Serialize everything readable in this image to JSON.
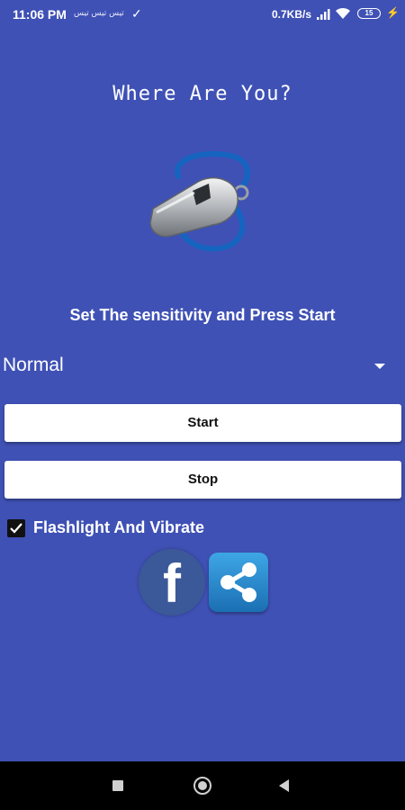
{
  "status_bar": {
    "time": "11:06 PM",
    "notifications": "تیس تیس تیس",
    "network_speed": "0.7KB/s",
    "battery_level": "15",
    "icons": [
      "download-done-icon",
      "signal-icon",
      "wifi-icon",
      "battery-icon",
      "charging-icon"
    ]
  },
  "app": {
    "title": "Where Are You?",
    "hero_icon": "whistle-icon",
    "instruction": "Set The sensitivity and Press Start",
    "sensitivity": {
      "selected": "Normal"
    },
    "buttons": {
      "start": "Start",
      "stop": "Stop"
    },
    "option": {
      "label": "Flashlight And Vibrate",
      "checked": true
    },
    "social": {
      "facebook_letter": "f",
      "icons": [
        "facebook-icon",
        "share-icon"
      ]
    }
  },
  "nav_bar": {
    "icons": [
      "recents-icon",
      "home-icon",
      "back-icon"
    ]
  },
  "colors": {
    "background": "#3f51b5",
    "facebook": "#3b5998",
    "share": "#2a8ad1",
    "navbar": "#000000"
  }
}
